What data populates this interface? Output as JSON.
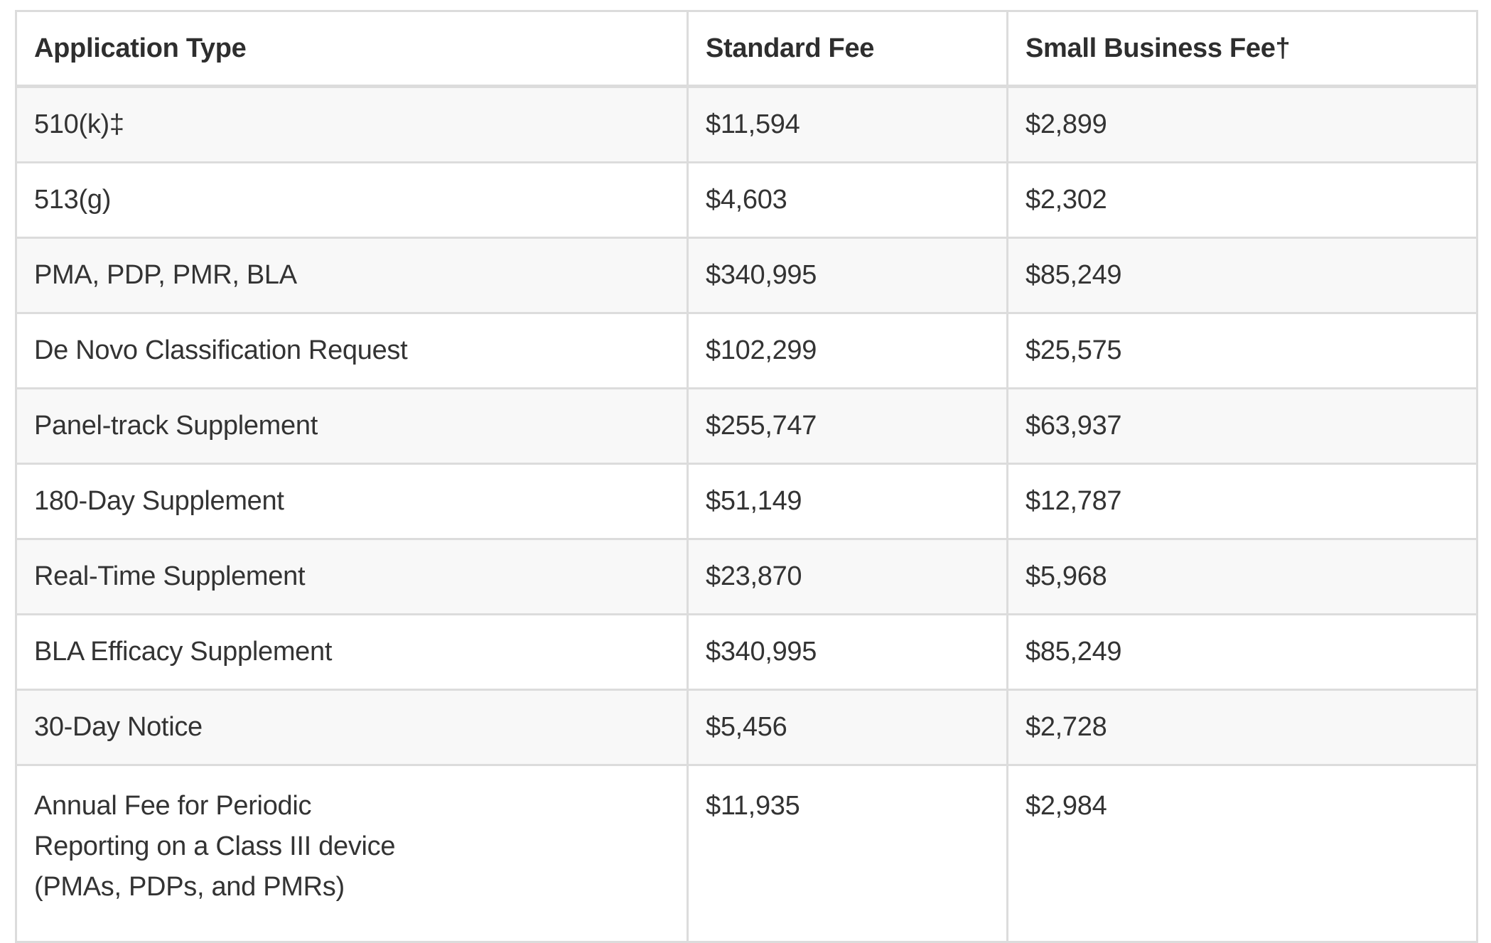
{
  "table": {
    "headers": [
      "Application Type",
      "Standard Fee",
      "Small Business Fee†"
    ],
    "rows": [
      [
        "510(k)‡",
        "$11,594",
        "$2,899"
      ],
      [
        "513(g)",
        "$4,603",
        "$2,302"
      ],
      [
        "PMA, PDP, PMR, BLA",
        "$340,995",
        "$85,249"
      ],
      [
        "De Novo Classification Request",
        "$102,299",
        "$25,575"
      ],
      [
        "Panel-track Supplement",
        "$255,747",
        "$63,937"
      ],
      [
        "180-Day Supplement",
        "$51,149",
        "$12,787"
      ],
      [
        "Real-Time Supplement",
        "$23,870",
        "$5,968"
      ],
      [
        "BLA Efficacy Supplement",
        "$340,995",
        "$85,249"
      ],
      [
        "30-Day Notice",
        "$5,456",
        "$2,728"
      ],
      [
        "Annual Fee for Periodic\nReporting on a Class III device\n(PMAs, PDPs, and PMRs)",
        "$11,935",
        "$2,984"
      ]
    ]
  }
}
